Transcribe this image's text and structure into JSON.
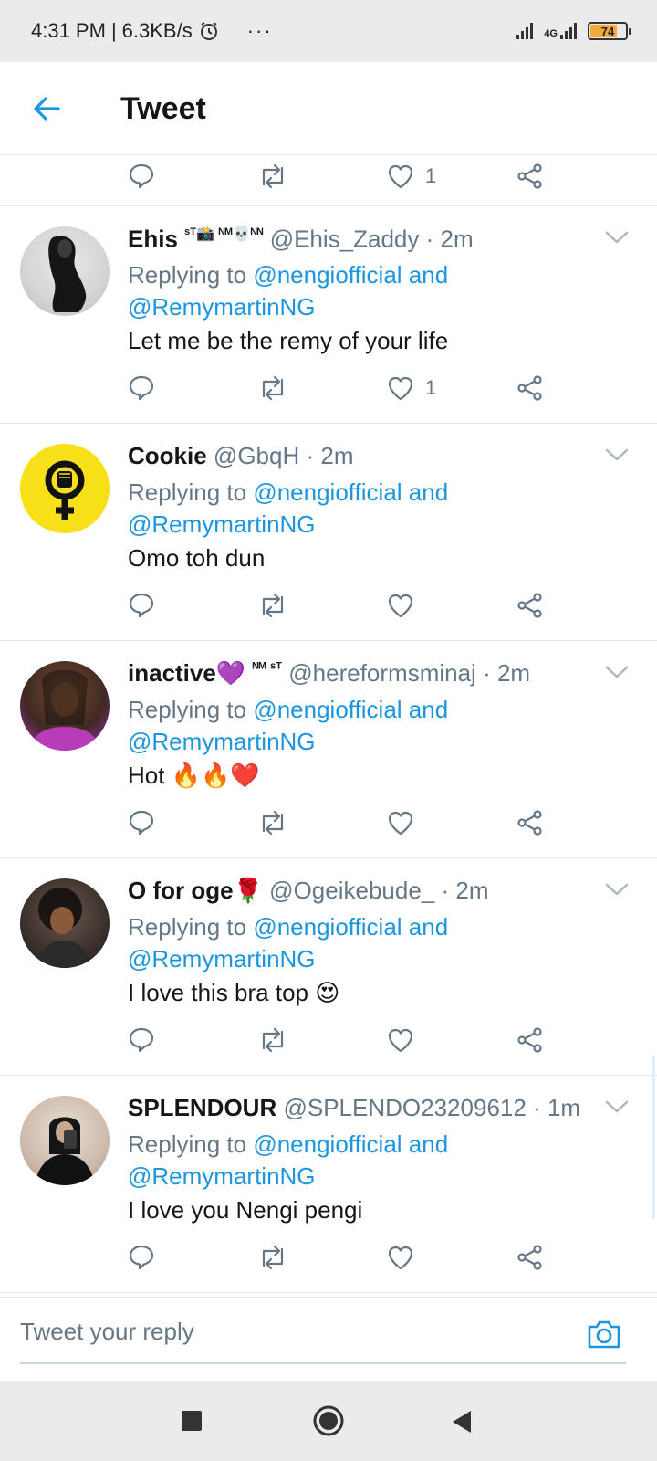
{
  "status_bar": {
    "time": "4:31 PM",
    "separator": "|",
    "speed": "6.3KB/s",
    "dots": "···",
    "network": "4G",
    "battery": "74"
  },
  "header": {
    "title": "Tweet",
    "back_icon": "arrow-left-icon"
  },
  "top_actions": {
    "like_count": "1"
  },
  "replying_label": "Replying to",
  "and_label": "and",
  "tweets": [
    {
      "name": "Ehis",
      "name_suffix": "ˢᵀ📸 ᴺᴹ💀ᴺᴺ",
      "handle": "@Ehis_Zaddy",
      "time": "2m",
      "mention1": "@nengiofficial",
      "mention2": "@RemymartinNG",
      "text": "Let me be the remy of your life",
      "like_count": "1"
    },
    {
      "name": "Cookie",
      "name_suffix": "",
      "handle": "@GbqH",
      "time": "2m",
      "mention1": "@nengiofficial",
      "mention2": "@RemymartinNG",
      "text": "Omo toh dun",
      "like_count": ""
    },
    {
      "name": "inactive💜",
      "name_suffix": "ᴺᴹ ˢᵀ",
      "handle": "@hereformsminaj",
      "time": "2m",
      "mention1": "@nengiofficial",
      "mention2": "@RemymartinNG",
      "text": "Hot 🔥🔥❤️",
      "like_count": ""
    },
    {
      "name": "O for oge🌹",
      "name_suffix": "",
      "handle": "@Ogeikebude_",
      "time": "2m",
      "mention1": "@nengiofficial",
      "mention2": "@RemymartinNG",
      "text": "I love this bra top 😍",
      "like_count": ""
    },
    {
      "name": "SPLENDOUR",
      "name_suffix": "",
      "handle": "@SPLENDO23209612",
      "time": "1m",
      "mention1": "@nengiofficial",
      "mention2": "@RemymartinNG",
      "text": "I love you Nengi pengi",
      "like_count": ""
    }
  ],
  "compose": {
    "placeholder": "Tweet your reply",
    "camera_icon": "camera-icon"
  },
  "colors": {
    "accent": "#1b95e0",
    "secondary_text": "#657786",
    "border": "#e1e8ed"
  }
}
